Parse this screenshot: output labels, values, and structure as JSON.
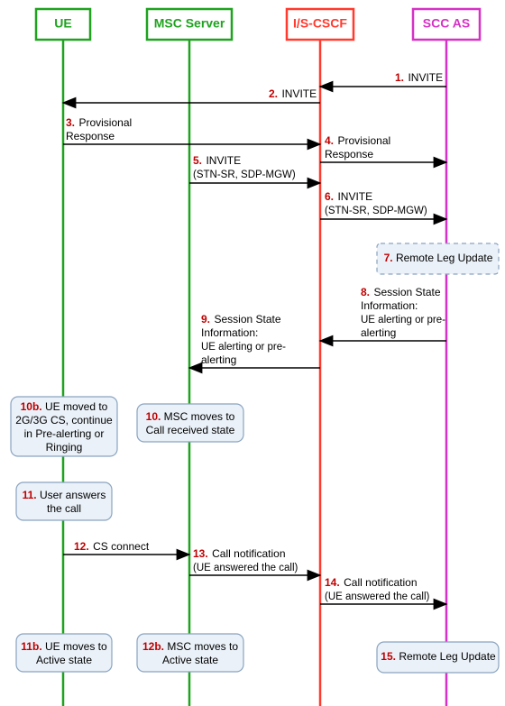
{
  "lanes": {
    "ue": {
      "label": "UE",
      "color": "#1fa31f"
    },
    "msc": {
      "label": "MSC Server",
      "color": "#1fa31f"
    },
    "cscf": {
      "label": "I/S-CSCF",
      "color": "#ff3a2e"
    },
    "scc": {
      "label": "SCC AS",
      "color": "#d631c5"
    }
  },
  "messages": {
    "m1": {
      "num": "1.",
      "txt": "INVITE"
    },
    "m2": {
      "num": "2.",
      "txt": "INVITE"
    },
    "m3a": {
      "num": "3.",
      "txt": "Provisional"
    },
    "m3b": {
      "txt": "Response"
    },
    "m4a": {
      "num": "4.",
      "txt": "Provisional"
    },
    "m4b": {
      "txt": "Response"
    },
    "m5a": {
      "num": "5.",
      "txt": "INVITE"
    },
    "m5b": {
      "txt": "(STN-SR, SDP-MGW)"
    },
    "m6a": {
      "num": "6.",
      "txt": "INVITE"
    },
    "m6b": {
      "txt": "(STN-SR, SDP-MGW)"
    },
    "m8a": {
      "num": "8.",
      "txt": "Session State"
    },
    "m8b": {
      "txt": "Information:"
    },
    "m8c": {
      "txt": "UE alerting or pre-"
    },
    "m8d": {
      "txt": "alerting"
    },
    "m9a": {
      "num": "9.",
      "txt": "Session State"
    },
    "m9b": {
      "txt": "Information:"
    },
    "m9c": {
      "txt": "UE alerting or pre-"
    },
    "m9d": {
      "txt": "alerting"
    },
    "m12": {
      "num": "12.",
      "txt": "CS connect"
    },
    "m13a": {
      "num": "13.",
      "txt": "Call notification"
    },
    "m13b": {
      "txt": "(UE answered the call)"
    },
    "m14a": {
      "num": "14.",
      "txt": "Call notification"
    },
    "m14b": {
      "txt": "(UE answered the call)"
    }
  },
  "notes": {
    "n7": {
      "num": "7.",
      "l1": "Remote Leg Update"
    },
    "n10b": {
      "num": "10b.",
      "l1": "UE moved to",
      "l2": "2G/3G CS, continue",
      "l3": "in Pre-alerting or",
      "l4": "Ringing"
    },
    "n10": {
      "num": "10.",
      "l1": "MSC moves to",
      "l2": "Call received state"
    },
    "n11": {
      "num": "11.",
      "l1": "User answers",
      "l2": "the call"
    },
    "n11b": {
      "num": "11b.",
      "l1": "UE moves to",
      "l2": "Active state"
    },
    "n12b": {
      "num": "12b.",
      "l1": "MSC moves to",
      "l2": "Active state"
    },
    "n15": {
      "num": "15.",
      "l1": "Remote Leg Update"
    }
  }
}
